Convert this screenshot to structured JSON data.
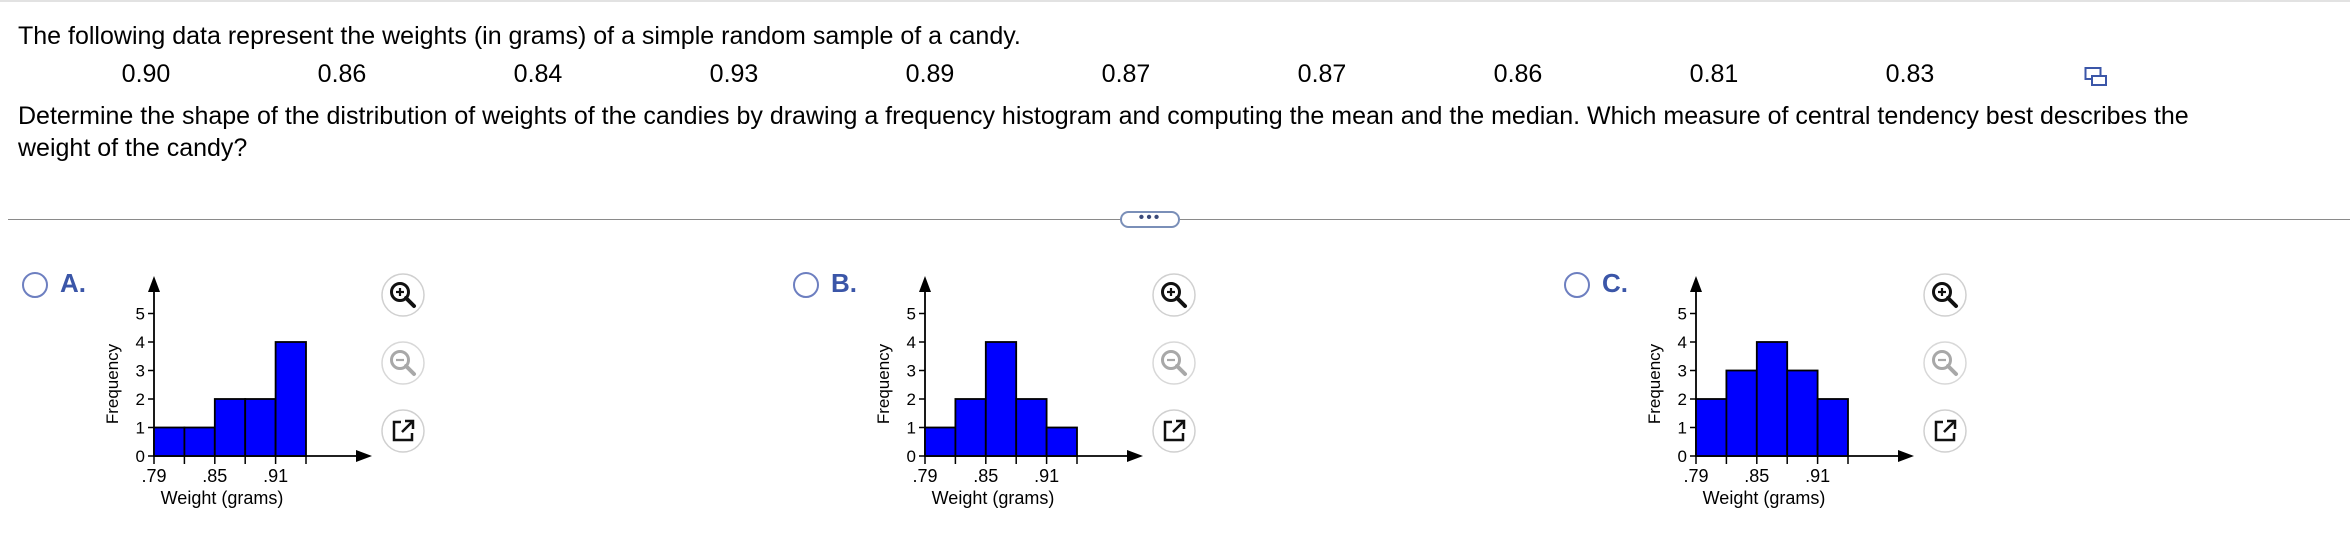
{
  "question": {
    "intro": "The following data represent the weights (in grams) of a simple random sample of a candy.",
    "data_values": [
      "0.90",
      "0.86",
      "0.84",
      "0.93",
      "0.89",
      "0.87",
      "0.87",
      "0.86",
      "0.81",
      "0.83"
    ],
    "prompt_line1": "Determine the shape of the distribution of weights of the candies by drawing a frequency histogram and computing the mean and the median. Which measure of central tendency best describes the",
    "prompt_line2": "weight of the candy?"
  },
  "more_button": "•••",
  "colors": {
    "bar_fill": "#0000ff",
    "accent": "#3b56a8",
    "radio_border": "#6d7fc0"
  },
  "options": [
    {
      "letter": "A.",
      "chart_data": {
        "type": "bar",
        "bin_edges": [
          0.79,
          0.82,
          0.85,
          0.88,
          0.91,
          0.94
        ],
        "values": [
          1,
          1,
          2,
          2,
          4
        ],
        "xlabel": "Weight (grams)",
        "ylabel": "Frequency",
        "x_tick_labels": [
          ".79",
          ".85",
          ".91"
        ],
        "y_tick_labels": [
          "0",
          "1",
          "2",
          "3",
          "4",
          "5"
        ],
        "ylim": [
          0,
          5
        ]
      }
    },
    {
      "letter": "B.",
      "chart_data": {
        "type": "bar",
        "bin_edges": [
          0.79,
          0.82,
          0.85,
          0.88,
          0.91,
          0.94
        ],
        "values": [
          1,
          2,
          4,
          2,
          1
        ],
        "xlabel": "Weight (grams)",
        "ylabel": "Frequency",
        "x_tick_labels": [
          ".79",
          ".85",
          ".91"
        ],
        "y_tick_labels": [
          "0",
          "1",
          "2",
          "3",
          "4",
          "5"
        ],
        "ylim": [
          0,
          5
        ]
      }
    },
    {
      "letter": "C.",
      "chart_data": {
        "type": "bar",
        "bin_edges": [
          0.79,
          0.82,
          0.85,
          0.88,
          0.91,
          0.94
        ],
        "values": [
          2,
          3,
          4,
          3,
          2
        ],
        "xlabel": "Weight (grams)",
        "ylabel": "Frequency",
        "x_tick_labels": [
          ".79",
          ".85",
          ".91"
        ],
        "y_tick_labels": [
          "0",
          "1",
          "2",
          "3",
          "4",
          "5"
        ],
        "ylim": [
          0,
          5
        ]
      }
    }
  ],
  "tool_icons": [
    "zoom-in-icon",
    "zoom-out-icon",
    "open-external-icon"
  ]
}
